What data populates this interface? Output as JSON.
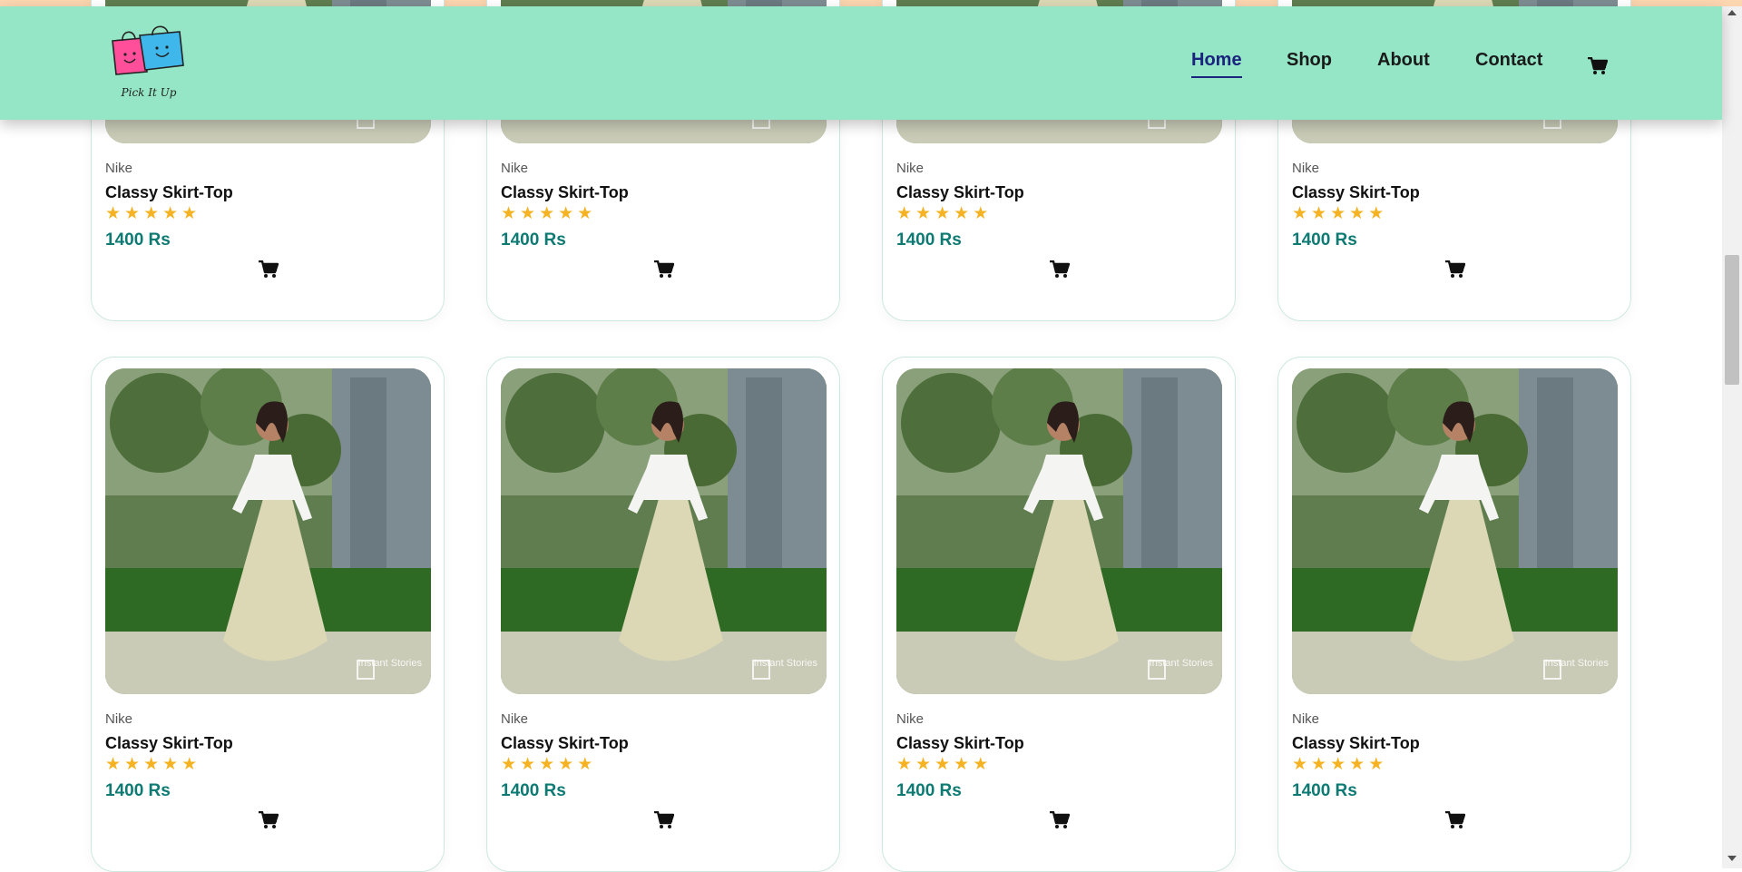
{
  "header": {
    "logo_text": "Pick It Up",
    "nav": [
      {
        "label": "Home",
        "active": true
      },
      {
        "label": "Shop",
        "active": false
      },
      {
        "label": "About",
        "active": false
      },
      {
        "label": "Contact",
        "active": false
      }
    ],
    "cart_icon": "cart-icon"
  },
  "products": [
    {
      "brand": "Nike",
      "name": "Classy Skirt-Top",
      "rating": 5,
      "price": "1400 Rs",
      "watermark": "Instant Stories"
    },
    {
      "brand": "Nike",
      "name": "Classy Skirt-Top",
      "rating": 5,
      "price": "1400 Rs",
      "watermark": "Instant Stories"
    },
    {
      "brand": "Nike",
      "name": "Classy Skirt-Top",
      "rating": 5,
      "price": "1400 Rs",
      "watermark": "Instant Stories"
    },
    {
      "brand": "Nike",
      "name": "Classy Skirt-Top",
      "rating": 5,
      "price": "1400 Rs",
      "watermark": "Instant Stories"
    },
    {
      "brand": "Nike",
      "name": "Classy Skirt-Top",
      "rating": 5,
      "price": "1400 Rs",
      "watermark": "Instant Stories"
    },
    {
      "brand": "Nike",
      "name": "Classy Skirt-Top",
      "rating": 5,
      "price": "1400 Rs",
      "watermark": "Instant Stories"
    },
    {
      "brand": "Nike",
      "name": "Classy Skirt-Top",
      "rating": 5,
      "price": "1400 Rs",
      "watermark": "Instant Stories"
    },
    {
      "brand": "Nike",
      "name": "Classy Skirt-Top",
      "rating": 5,
      "price": "1400 Rs",
      "watermark": "Instant Stories"
    }
  ],
  "colors": {
    "header_bg": "#94e6c6",
    "active_nav": "#1a237e",
    "star": "#f5b323",
    "price": "#0d7a73"
  }
}
